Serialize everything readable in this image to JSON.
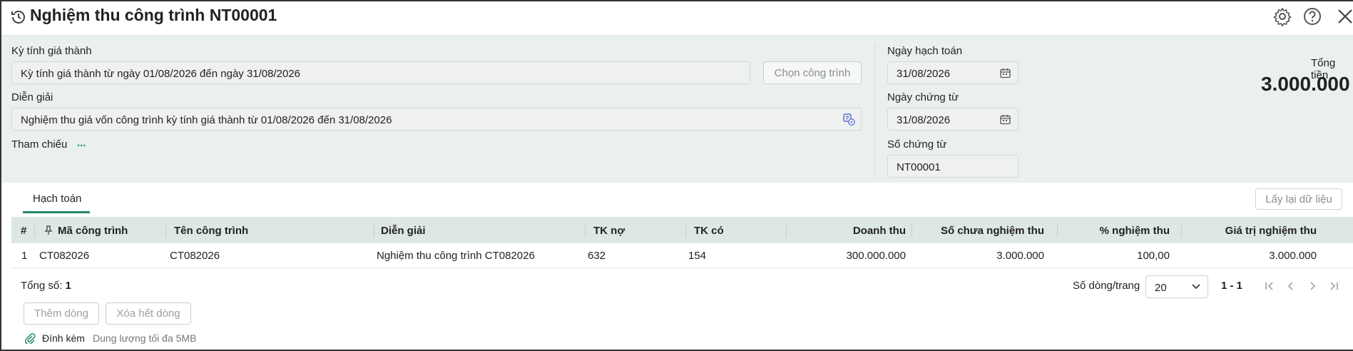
{
  "title": "Nghiệm thu công trình NT00001",
  "form": {
    "period_label": "Kỳ tính giá thành",
    "period_value": "Kỳ tính giá thành từ ngày 01/08/2026 đến ngày 31/08/2026",
    "choose_project_button": "Chọn công trình",
    "description_label": "Diễn giải",
    "description_value": "Nghiệm thu giá vốn công trình kỳ tính giá thành từ 01/08/2026 đến 31/08/2026",
    "reference_label": "Tham chiếu",
    "reference_more": "...",
    "posting_date_label": "Ngày hạch toán",
    "posting_date_value": "31/08/2026",
    "voucher_date_label": "Ngày chứng từ",
    "voucher_date_value": "31/08/2026",
    "voucher_no_label": "Số chứng từ",
    "voucher_no_value": "NT00001",
    "total_label": "Tổng tiền",
    "total_value": "3.000.000"
  },
  "tabs": [
    {
      "label": "Hạch toán"
    }
  ],
  "reload_button": "Lấy lại dữ liệu",
  "table": {
    "columns": [
      "#",
      "Mã công trình",
      "Tên công trình",
      "Diễn giải",
      "TK nợ",
      "TK có",
      "Doanh thu",
      "Số chưa nghiệm thu",
      "% nghiệm thu",
      "Giá trị nghiệm thu"
    ],
    "rows": [
      [
        "1",
        "CT082026",
        "CT082026",
        "Nghiệm thu công trình CT082026",
        "632",
        "154",
        "300.000.000",
        "3.000.000",
        "100,00",
        "3.000.000"
      ]
    ]
  },
  "footer": {
    "total_label": "Tổng số:",
    "total_count": "1",
    "rows_per_page_label": "Số dòng/trang",
    "rows_per_page_value": "20",
    "page_range": "1 - 1",
    "add_row_button": "Thêm dòng",
    "delete_all_button": "Xóa hết dòng",
    "attach_label": "Đính kèm",
    "attach_hint": "Dung lượng tối đa 5MB"
  },
  "colors": {
    "accent": "#1f8a62",
    "form_bg": "#eaf0ee",
    "header_bg": "#dde7e3"
  },
  "icons": [
    "history-icon",
    "gear-icon",
    "help-icon",
    "close-icon",
    "calendar-icon",
    "translate-icon",
    "pin-icon",
    "chevron-down-icon",
    "first-page-icon",
    "prev-page-icon",
    "next-page-icon",
    "last-page-icon",
    "paperclip-icon"
  ]
}
